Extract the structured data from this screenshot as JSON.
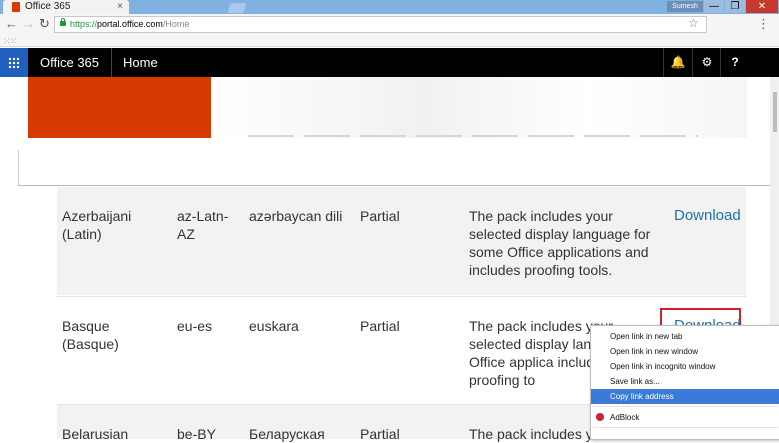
{
  "browser": {
    "tab_title": "Office 365",
    "tab_close": "×",
    "user_badge": "Sumesh",
    "url_scheme": "https://",
    "url_host": "portal.office.com",
    "url_path": "/Home",
    "window_buttons": {
      "minimize": "—",
      "maximize": "❐",
      "close": "✕"
    },
    "icons": [
      "back-icon",
      "forward-icon",
      "reload-icon",
      "lock-icon",
      "star-icon",
      "menu-icon",
      "apps-icon"
    ]
  },
  "suite_bar": {
    "brand": "Office 365",
    "page": "Home",
    "icons": [
      "app-launcher-icon",
      "bell-icon",
      "gear-icon",
      "help-icon"
    ],
    "bell_glyph": "🔔",
    "gear_glyph": "⚙",
    "help_glyph": "?"
  },
  "colors": {
    "brand_orange": "#d83b01",
    "launcher_blue": "#1f5fbf",
    "link_blue": "#1e6fa9",
    "highlight_red": "#d0202e",
    "menu_selected": "#3b7ad8"
  },
  "languages": [
    {
      "language": "Azerbaijani (Latin)",
      "code": "az-Latn-AZ",
      "native": "azərbaycan dili",
      "level": "Partial",
      "description": "The pack includes your selected display language for some Office applications and includes proofing tools.",
      "action": "Download"
    },
    {
      "language": "Basque (Basque)",
      "code": "eu-es",
      "native": "euskara",
      "level": "Partial",
      "description": "The pack includes your selected display lan some Office applica includes proofing to",
      "action": "Download"
    },
    {
      "language": "Belarusian",
      "code": "be-BY",
      "native": "Беларуская",
      "level": "Partial",
      "description": "The pack includes your s",
      "action": ""
    }
  ],
  "context_menu": {
    "items": [
      {
        "label": "Open link in new tab"
      },
      {
        "label": "Open link in new window"
      },
      {
        "label": "Open link in incognito window"
      },
      {
        "label": "Save link as..."
      },
      {
        "label": "Copy link address",
        "selected": true
      },
      {
        "label": "AdBlock",
        "icon": "adblock-icon"
      }
    ]
  }
}
